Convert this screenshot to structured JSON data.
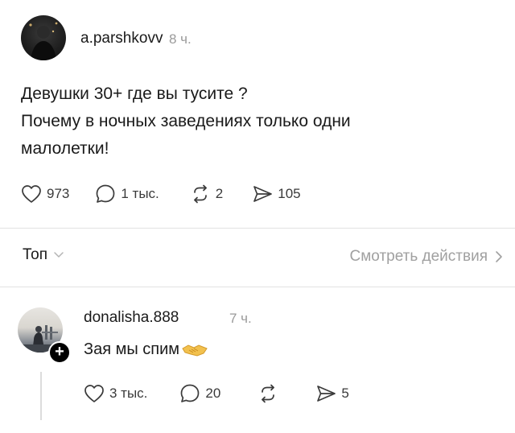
{
  "post": {
    "username": "a.parshkovv",
    "time": "8 ч.",
    "lines": [
      "Девушки 30+ где вы тусите ?",
      "Почему в ночных заведениях только  одни",
      "малолетки!"
    ],
    "likes": "973",
    "comments": "1 тыс.",
    "reposts": "2",
    "shares": "105"
  },
  "sort": {
    "label": "Топ",
    "view_actions": "Смотреть действия"
  },
  "reply": {
    "username": "donalisha.888",
    "time": "7 ч.",
    "text": "Зая мы спим",
    "likes": "3 тыс.",
    "comments": "20",
    "shares": "5"
  },
  "icons": {
    "like": "heart-icon",
    "comment": "comment-bubble-icon",
    "repost": "repost-icon",
    "share": "send-icon",
    "handshake": "handshake-emoji-icon",
    "follow": "plus-icon",
    "chevron_down": "chevron-down-icon",
    "chevron_right": "chevron-right-icon"
  }
}
